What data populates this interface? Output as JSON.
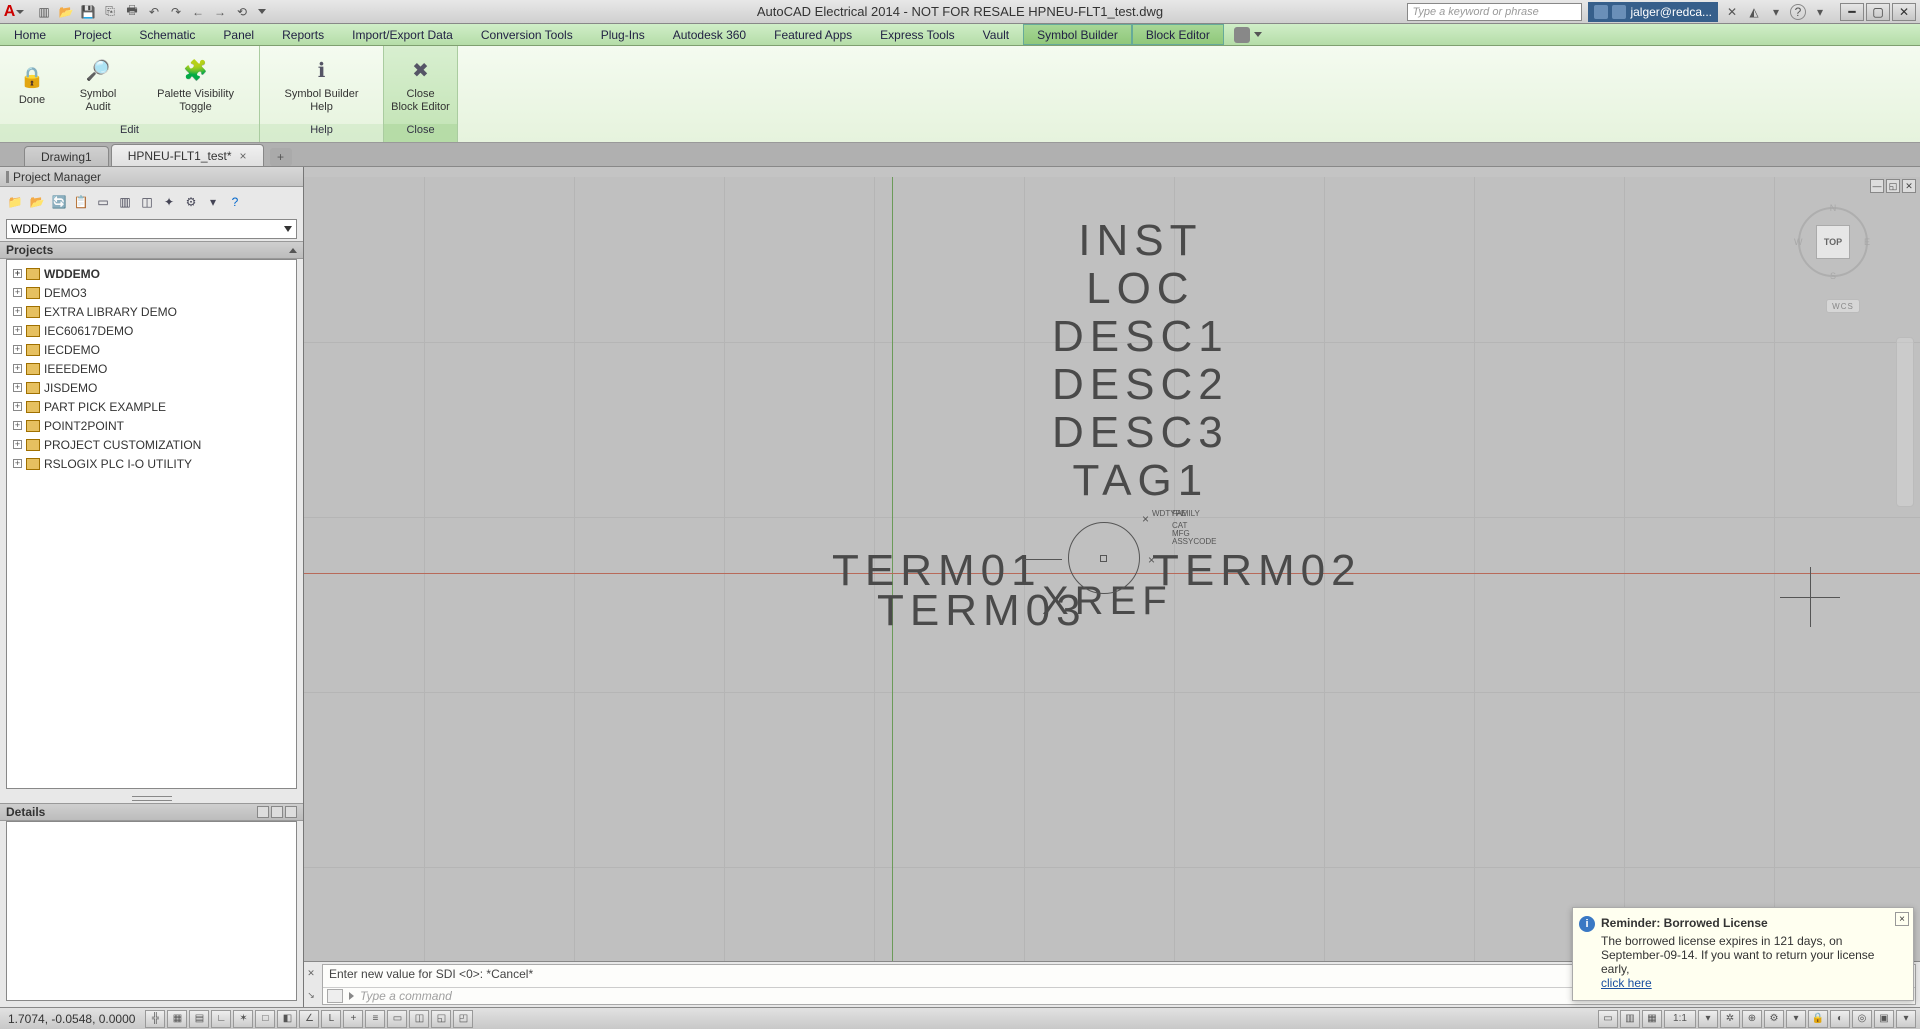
{
  "title": "AutoCAD Electrical 2014 - NOT FOR RESALE    HPNEU-FLT1_test.dwg",
  "search_placeholder": "Type a keyword or phrase",
  "user": "jalger@redca...",
  "menus": [
    "Home",
    "Project",
    "Schematic",
    "Panel",
    "Reports",
    "Import/Export Data",
    "Conversion Tools",
    "Plug-Ins",
    "Autodesk 360",
    "Featured Apps",
    "Express Tools",
    "Vault",
    "Symbol Builder",
    "Block Editor"
  ],
  "active_menus": [
    "Symbol Builder",
    "Block Editor"
  ],
  "ribbon": {
    "groups": [
      {
        "label": "Edit",
        "buttons": [
          {
            "name": "done",
            "label": "Done",
            "icon": "🔒"
          },
          {
            "name": "symbol-audit",
            "label": "Symbol Audit",
            "icon": "🔍"
          },
          {
            "name": "palette-visibility-toggle",
            "label": "Palette Visibility Toggle",
            "icon": "🧩"
          }
        ]
      },
      {
        "label": "Help",
        "buttons": [
          {
            "name": "symbol-builder-help",
            "label": "Symbol Builder Help",
            "icon": "ℹ"
          }
        ]
      },
      {
        "label": "Close",
        "buttons": [
          {
            "name": "close-block-editor",
            "label": "Close\nBlock Editor",
            "icon": "✖"
          }
        ]
      }
    ]
  },
  "tabs": [
    {
      "label": "Drawing1",
      "active": false
    },
    {
      "label": "HPNEU-FLT1_test*",
      "active": true
    }
  ],
  "pm": {
    "title": "Project Manager",
    "select": "WDDEMO",
    "projects_header": "Projects",
    "details_header": "Details",
    "tree": [
      {
        "label": "WDDEMO",
        "bold": true
      },
      {
        "label": "DEMO3"
      },
      {
        "label": "EXTRA LIBRARY DEMO"
      },
      {
        "label": "IEC60617DEMO"
      },
      {
        "label": "IECDEMO"
      },
      {
        "label": "IEEEDEMO"
      },
      {
        "label": "JISDEMO"
      },
      {
        "label": "PART PICK EXAMPLE"
      },
      {
        "label": "POINT2POINT"
      },
      {
        "label": "PROJECT CUSTOMIZATION"
      },
      {
        "label": "RSLOGIX PLC I-O UTILITY"
      }
    ]
  },
  "symbol": {
    "lines": [
      "INST",
      "LOC",
      "DESC1",
      "DESC2",
      "DESC3",
      "TAG1"
    ],
    "term01": "TERM01",
    "term02": "TERM02",
    "term03": "TERM03",
    "xref": "XREF",
    "annot": [
      "WDTYPE",
      "FAMILY",
      "CAT",
      "MFG",
      "ASSYCODE"
    ]
  },
  "viewcube": {
    "face": "TOP",
    "n": "N",
    "s": "S",
    "e": "E",
    "w": "W",
    "wcs": "WCS"
  },
  "cmd": {
    "history": "Enter new value for SDI <0>: *Cancel*",
    "placeholder": "Type a command"
  },
  "status": {
    "coords": "1.7074, -0.0548, 0.0000",
    "scale": "1:1"
  },
  "balloon": {
    "title": "Reminder: Borrowed License",
    "body": "The borrowed license expires in 121 days, on September-09-14. If you want to return your license early,",
    "link": "click here"
  }
}
